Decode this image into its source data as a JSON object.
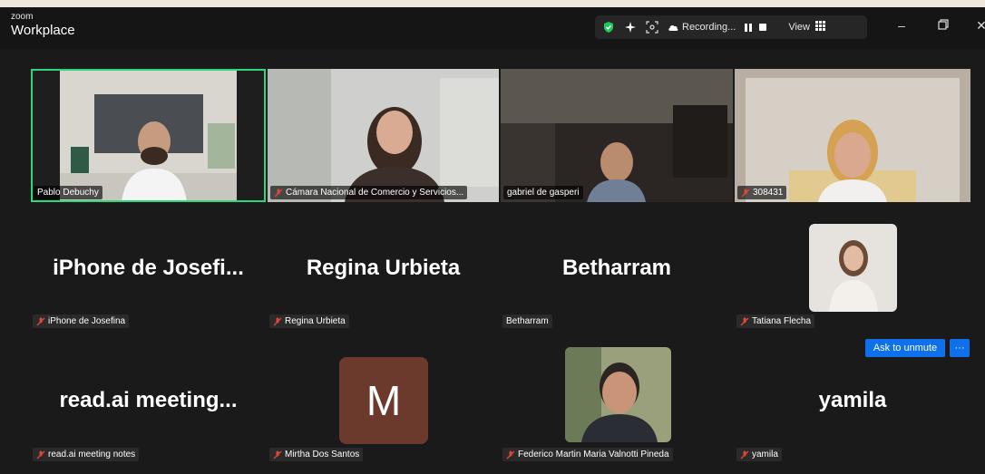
{
  "app": {
    "brand_small": "zoom",
    "brand_title": "Workplace"
  },
  "toolbar": {
    "recording_label": "Recording...",
    "view_label": "View",
    "icons": [
      "shield-check-icon",
      "sparkle-icon",
      "focus-icon",
      "cloud-icon",
      "pause-icon",
      "stop-icon",
      "grid-icon"
    ],
    "colors": {
      "shield": "#22c55e",
      "active_outline": "#2fd67a",
      "button_blue": "#0e71eb"
    }
  },
  "video_tiles": [
    {
      "name": "Pablo Debuchy",
      "muted": false,
      "active": true
    },
    {
      "name": "Cámara Nacional de Comercio y Servicios...",
      "muted": true
    },
    {
      "name": "gabriel de gasperi",
      "muted": false
    },
    {
      "name": "308431",
      "muted": true
    }
  ],
  "name_tiles": [
    {
      "display": "iPhone de Josefi...",
      "tag": "iPhone de Josefina",
      "muted": true
    },
    {
      "display": "Regina Urbieta",
      "tag": "Regina Urbieta",
      "muted": true
    },
    {
      "display": "Betharram",
      "tag": "Betharram",
      "muted": false
    },
    {
      "tag": "Tatiana Flecha",
      "muted": true
    }
  ],
  "bottom_tiles": [
    {
      "display": "read.ai meeting...",
      "tag": "read.ai meeting notes",
      "muted": true
    },
    {
      "avatar_letter": "M",
      "tag": "Mirtha Dos Santos",
      "muted": true
    },
    {
      "tag": "Federico Martin Maria Valnotti Pineda",
      "muted": true
    },
    {
      "display": "yamila",
      "tag": "yamila",
      "muted": true
    }
  ],
  "actions": {
    "ask_to_unmute": "Ask to unmute",
    "more": "···"
  }
}
